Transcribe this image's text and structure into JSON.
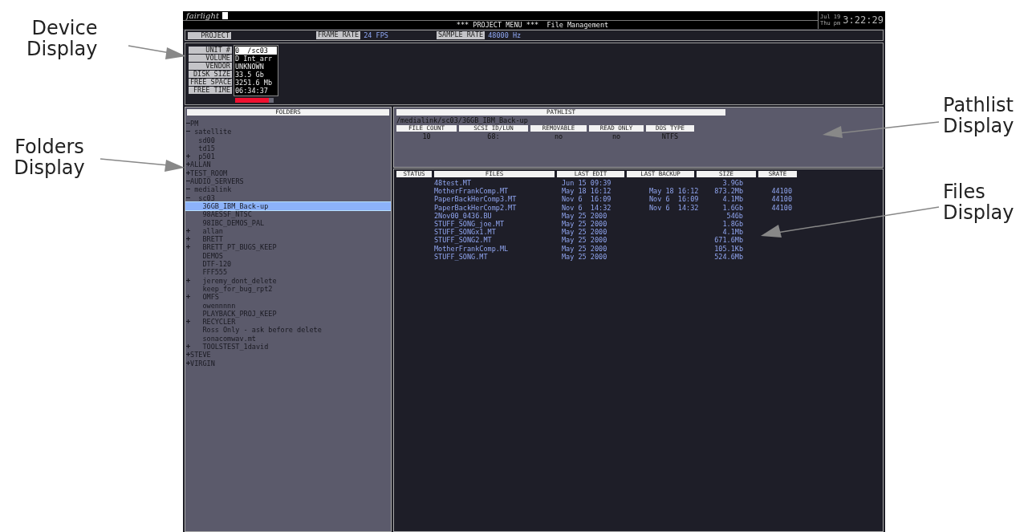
{
  "callouts_left": [
    {
      "text": "Device Display"
    },
    {
      "text": "Folders Display"
    }
  ],
  "callouts_right": [
    {
      "text": "Pathlist Display"
    },
    {
      "text": "Files Display"
    }
  ],
  "header": {
    "logo": "fairlight",
    "title": "*** PROJECT MENU ***  File Management",
    "date": "Jul 19",
    "day": "Thu pm",
    "time": "3:22:29"
  },
  "info_bar": {
    "project_label": "PROJECT",
    "fields": [
      {
        "label": "FRAME RATE",
        "value": "24 FPS"
      },
      {
        "label": "SAMPLE RATE",
        "value": "48000 Hz"
      }
    ]
  },
  "device": {
    "rows": [
      {
        "label": "UNIT #",
        "value": "0  /sc03",
        "selected": true
      },
      {
        "label": "VOLUME",
        "value": "D Int_arr",
        "selected": false
      },
      {
        "label": "VENDOR",
        "value": "UNKNOWN",
        "selected": false
      },
      {
        "label": "DISK SIZE",
        "value": "33.5 Gb",
        "selected": false
      },
      {
        "label": "FREE SPACE",
        "value": "3251.6 Mb",
        "selected": false
      },
      {
        "label": "FREE TIME",
        "value": "06:34:37",
        "selected": false
      }
    ],
    "meter": {
      "level": 0.88
    }
  },
  "folders": {
    "title": "FOLDERS",
    "tree": [
      {
        "name": "PM",
        "kind": "branch",
        "expanded": true,
        "selected": false,
        "children": [
          {
            "name": "satellite",
            "kind": "branch",
            "expanded": true,
            "selected": false,
            "children": [
              {
                "name": "sd00",
                "kind": "leaf",
                "selected": false
              },
              {
                "name": "td15",
                "kind": "leaf",
                "selected": false
              },
              {
                "name": "p501",
                "kind": "branch",
                "expanded": false,
                "selected": false
              }
            ]
          }
        ]
      },
      {
        "name": "ALLAN",
        "kind": "branch",
        "expanded": false,
        "selected": false
      },
      {
        "name": "TEST_ROOM",
        "kind": "branch",
        "expanded": false,
        "selected": false
      },
      {
        "name": "AUDIO_SERVERS",
        "kind": "branch",
        "expanded": true,
        "selected": false,
        "children": [
          {
            "name": "medialink",
            "kind": "branch",
            "expanded": true,
            "selected": false,
            "children": [
              {
                "name": "sc03",
                "kind": "branch",
                "expanded": true,
                "selected": false,
                "children": [
                  {
                    "name": "36GB_IBM_Back-up",
                    "kind": "leaf",
                    "selected": true
                  },
                  {
                    "name": "98AESSF_NTSC",
                    "kind": "leaf",
                    "selected": false
                  },
                  {
                    "name": "98IBC_DEMOS_PAL",
                    "kind": "leaf",
                    "selected": false
                  },
                  {
                    "name": "allan",
                    "kind": "branch",
                    "expanded": false,
                    "selected": false
                  },
                  {
                    "name": "BRETT",
                    "kind": "branch",
                    "expanded": false,
                    "selected": false
                  },
                  {
                    "name": "BRETT_PT_BUGS_KEEP",
                    "kind": "branch",
                    "expanded": false,
                    "selected": false
                  },
                  {
                    "name": "DEMOS",
                    "kind": "leaf",
                    "selected": false
                  },
                  {
                    "name": "DTF-120",
                    "kind": "leaf",
                    "selected": false
                  },
                  {
                    "name": "FFF555",
                    "kind": "leaf",
                    "selected": false
                  },
                  {
                    "name": "jeremy_dont_delete",
                    "kind": "branch",
                    "expanded": false,
                    "selected": false
                  },
                  {
                    "name": "keep_for_bug_rpt2",
                    "kind": "leaf",
                    "selected": false
                  },
                  {
                    "name": "OMFS",
                    "kind": "branch",
                    "expanded": false,
                    "selected": false
                  },
                  {
                    "name": "owennnnn",
                    "kind": "leaf",
                    "selected": false
                  },
                  {
                    "name": "PLAYBACK_PROJ_KEEP",
                    "kind": "leaf",
                    "selected": false
                  },
                  {
                    "name": "RECYCLER",
                    "kind": "branch",
                    "expanded": false,
                    "selected": false
                  },
                  {
                    "name": "Ross Only - ask before delete",
                    "kind": "leaf",
                    "selected": false
                  },
                  {
                    "name": "sonacomwav.mt",
                    "kind": "leaf",
                    "selected": false
                  },
                  {
                    "name": "TOOLSTEST_1david",
                    "kind": "branch",
                    "expanded": false,
                    "selected": false
                  }
                ]
              }
            ]
          }
        ]
      },
      {
        "name": "STEVE",
        "kind": "branch",
        "expanded": false,
        "selected": false
      },
      {
        "name": "VIRGIN",
        "kind": "branch",
        "expanded": false,
        "selected": false
      }
    ]
  },
  "pathlist": {
    "title": "PATHLIST",
    "path": "/medialink/sc03/36GB_IBM_Back-up",
    "info": [
      {
        "label": "FILE COUNT",
        "value": "10"
      },
      {
        "label": "SCSI ID/LUN",
        "value": "68:"
      },
      {
        "label": "REMOVABLE",
        "value": "no"
      },
      {
        "label": "READ ONLY",
        "value": "no"
      },
      {
        "label": "DOS TYPE",
        "value": "NTFS"
      }
    ]
  },
  "files": {
    "columns": [
      "STATUS",
      "FILES",
      "LAST EDIT",
      "LAST BACKUP",
      "SIZE",
      "SRATE"
    ],
    "rows": [
      {
        "file": "48test.MT",
        "last_edit": "Jun 15 09:39",
        "size": "3.9Gb"
      },
      {
        "file": "MotherFrankComp.MT",
        "last_edit": "May 18 16:12",
        "last_backup": "May 18 16:12",
        "size": "873.2Mb",
        "srate": "44100"
      },
      {
        "file": "PaperBackHerComp3.MT",
        "last_edit": "Nov 6  16:09",
        "last_backup": "Nov 6  16:09",
        "size": "4.1Mb",
        "srate": "44100"
      },
      {
        "file": "PaperBackHerComp2.MT",
        "last_edit": "Nov 6  14:32",
        "last_backup": "Nov 6  14:32",
        "size": "1.6Gb",
        "srate": "44100"
      },
      {
        "file": "2Nov00_0436.BU",
        "last_edit": "May 25 2000",
        "size": "546b"
      },
      {
        "file": "STUFF_SONG_joe.MT",
        "last_edit": "May 25 2000",
        "size": "1.8Gb"
      },
      {
        "file": "STUFF_SONGx1.MT",
        "last_edit": "May 25 2000",
        "size": "4.1Mb"
      },
      {
        "file": "STUFF_SONG2.MT",
        "last_edit": "May 25 2000",
        "size": "671.6Mb"
      },
      {
        "file": "MotherFrankComp.ML",
        "last_edit": "May 25 2000",
        "size": "105.1Kb"
      },
      {
        "file": "STUFF_SONG.MT",
        "last_edit": "May 25 2000",
        "size": "524.6Mb"
      }
    ]
  }
}
